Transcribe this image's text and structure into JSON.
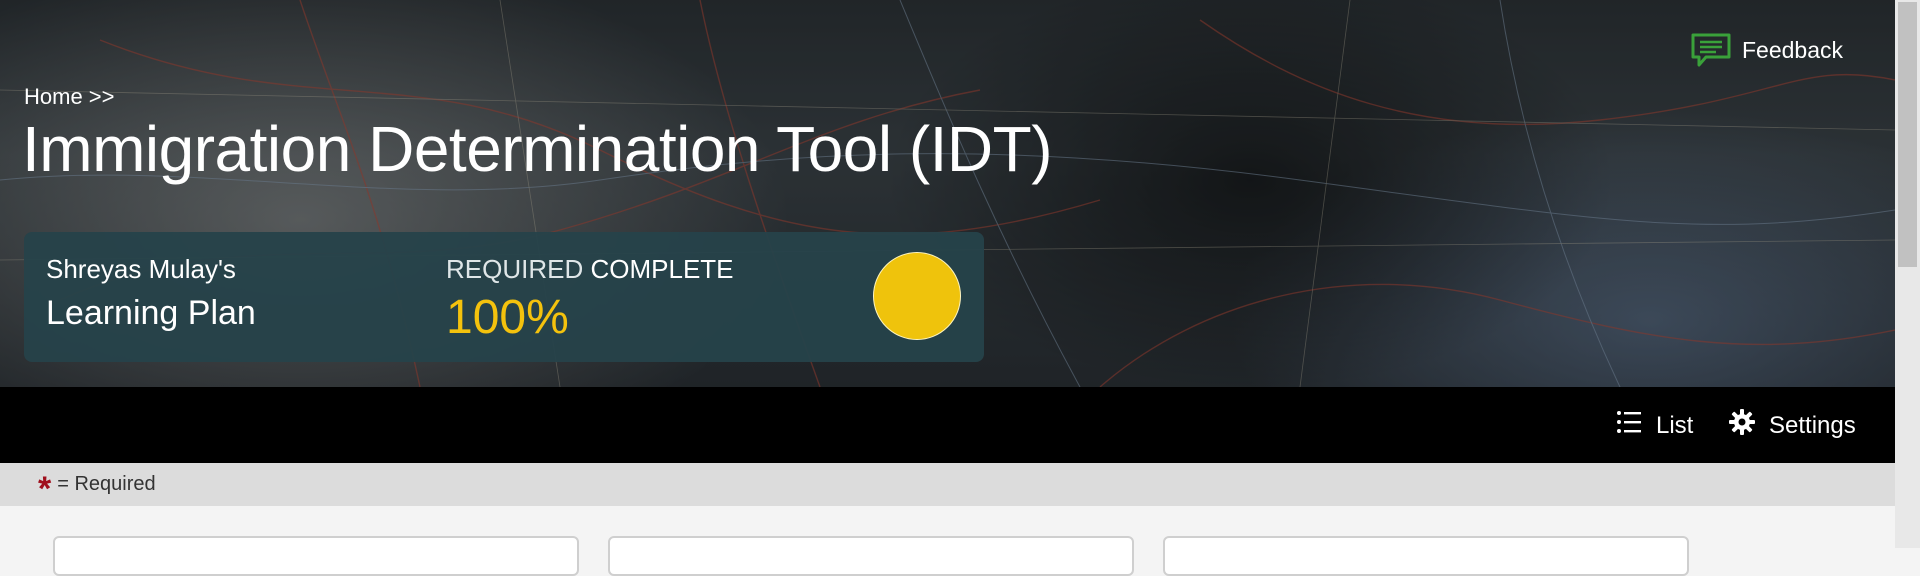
{
  "header": {
    "breadcrumb": "Home >>",
    "title": "Immigration Determination Tool (IDT)",
    "feedback_label": "Feedback"
  },
  "plan_card": {
    "owner": "Shreyas Mulay's",
    "label": "Learning Plan",
    "required_prefix": "REQUIRED",
    "required_suffix": "COMPLETE",
    "percent_text": "100%",
    "progress_fraction": 1.0
  },
  "toolbar": {
    "list_label": "List",
    "settings_label": "Settings"
  },
  "legend": {
    "star": "*",
    "text": "= Required"
  },
  "icons": {
    "feedback": "speech-bubble-icon",
    "list": "list-icon",
    "settings": "gear-icon"
  },
  "colors": {
    "card_bg": "#26424a",
    "accent_yellow": "#f4c20d",
    "required_red": "#a0101d",
    "feedback_green": "#3aa13a"
  }
}
